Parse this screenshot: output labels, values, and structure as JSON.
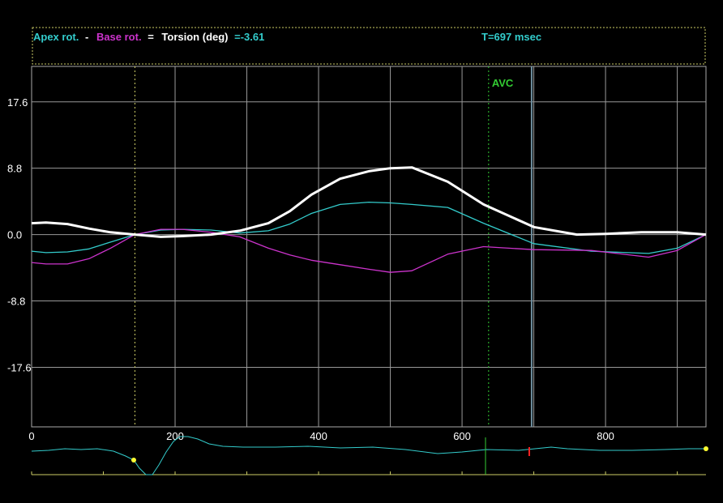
{
  "legend": {
    "apex_label": "Apex rot.",
    "minus_sign": "-",
    "base_label": "Base rot.",
    "equals_sign": "=",
    "torsion_label": "Torsion (deg)",
    "torsion_value": "=-3.61",
    "time_readout": "T=697 msec"
  },
  "colors": {
    "background": "#000000",
    "apex": "#33cccc",
    "base": "#cc33cc",
    "torsion": "#ffffff",
    "grid": "#999999",
    "dotted_frame": "#cccc66",
    "avc": "#33cc33",
    "cursor": "#6f8f9f",
    "ecg": "#33cccc",
    "ecg_marker": "#ffff33",
    "ecg_red": "#ff2222"
  },
  "chart_data": {
    "type": "line",
    "xlim": [
      0,
      940
    ],
    "ylim": [
      -25.5,
      22.3
    ],
    "x_ticks": [
      0,
      200,
      400,
      600,
      800
    ],
    "x_tick_labels": [
      "0",
      "200",
      "400",
      "600",
      "800"
    ],
    "y_ticks": [
      17.6,
      8.8,
      0.0,
      -8.8,
      -17.6
    ],
    "y_tick_labels": [
      "17.6",
      "8.8",
      "0.0",
      "-8.8",
      "-17.6"
    ],
    "grid": true,
    "avc": {
      "x": 637,
      "label": "AVC"
    },
    "cursor_x": 697,
    "window_start_x": 144,
    "series": [
      {
        "name": "Apex rot.",
        "color_key": "apex",
        "x": [
          0,
          20,
          50,
          80,
          110,
          144,
          180,
          210,
          250,
          290,
          330,
          360,
          390,
          430,
          470,
          500,
          530,
          580,
          630,
          700,
          780,
          860,
          900,
          940
        ],
        "y": [
          -2.2,
          -2.4,
          -2.3,
          -1.9,
          -1.0,
          0.0,
          0.6,
          0.7,
          0.6,
          0.2,
          0.5,
          1.4,
          2.8,
          4.0,
          4.3,
          4.2,
          4.0,
          3.6,
          1.5,
          -1.2,
          -2.2,
          -2.5,
          -1.8,
          0.0
        ]
      },
      {
        "name": "Base rot.",
        "color_key": "base",
        "x": [
          0,
          20,
          50,
          80,
          110,
          144,
          180,
          210,
          250,
          290,
          330,
          360,
          390,
          430,
          470,
          500,
          530,
          580,
          630,
          700,
          780,
          860,
          900,
          940
        ],
        "y": [
          -3.7,
          -3.9,
          -3.9,
          -3.2,
          -1.8,
          0.0,
          0.7,
          0.7,
          0.3,
          -0.3,
          -1.8,
          -2.7,
          -3.4,
          -4.0,
          -4.6,
          -5.0,
          -4.8,
          -2.6,
          -1.6,
          -2.0,
          -2.1,
          -3.0,
          -2.1,
          0.0
        ]
      },
      {
        "name": "Torsion (deg)",
        "color_key": "torsion",
        "x": [
          0,
          20,
          50,
          80,
          110,
          144,
          180,
          210,
          250,
          290,
          330,
          360,
          390,
          430,
          470,
          500,
          530,
          580,
          630,
          700,
          760,
          800,
          850,
          900,
          940
        ],
        "y": [
          1.5,
          1.6,
          1.4,
          0.8,
          0.3,
          0.0,
          -0.3,
          -0.2,
          0.0,
          0.5,
          1.5,
          3.1,
          5.3,
          7.4,
          8.4,
          8.8,
          8.9,
          7.0,
          4.0,
          1.0,
          0.0,
          0.1,
          0.3,
          0.3,
          0.0
        ]
      }
    ]
  }
}
